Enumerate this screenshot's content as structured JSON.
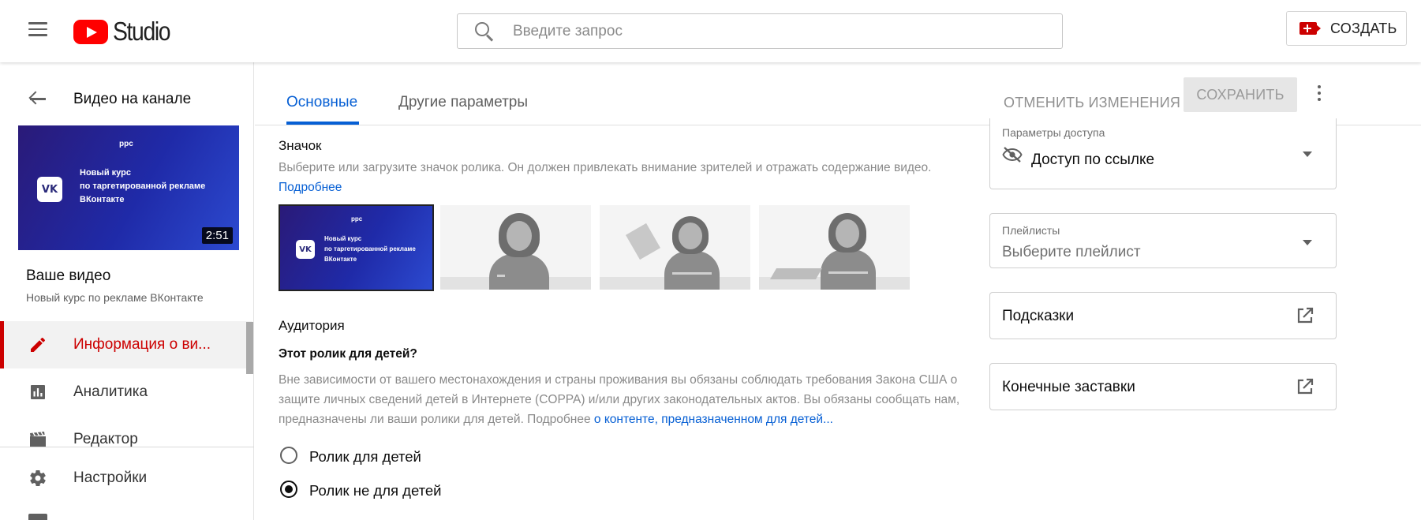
{
  "app": {
    "logo_text": "Studio",
    "search_placeholder": "Введите запрос",
    "create_label": "СОЗДАТЬ"
  },
  "sidebar": {
    "back_title": "Видео на канале",
    "thumbnail": {
      "brand": "ppc",
      "vk_mark": "VK",
      "course_lines": [
        "Новый курс",
        "по таргетированной рекламе",
        "ВКонтакте"
      ],
      "duration": "2:51"
    },
    "your_video_title": "Ваше видео",
    "your_video_subtitle": "Новый курс по рекламе ВКонтакте",
    "items": [
      {
        "label": "Информация о ви...",
        "icon": "pencil-icon",
        "active": true
      },
      {
        "label": "Аналитика",
        "icon": "analytics-icon",
        "active": false
      },
      {
        "label": "Редактор",
        "icon": "film-icon",
        "active": false
      },
      {
        "label": "Настройки",
        "icon": "gear-icon",
        "active": false
      }
    ]
  },
  "tabs": {
    "basic": "Основные",
    "other": "Другие параметры",
    "cancel": "ОТМЕНИТЬ ИЗМЕНЕНИЯ",
    "save": "СОХРАНИТЬ"
  },
  "main": {
    "thumbnail_section": {
      "title": "Значок",
      "description": "Выберите или загрузите значок ролика. Он должен привлекать внимание зрителей и отражать содержание видео.",
      "link": "Подробнее",
      "selected_thumb": {
        "brand": "ppc",
        "vk_mark": "VK",
        "course_lines": [
          "Новый курс",
          "по таргетированной рекламе",
          "ВКонтакте"
        ]
      }
    },
    "audience_section": {
      "title": "Аудитория",
      "question": "Этот ролик для детей?",
      "description": "Вне зависимости от вашего местонахождения и страны проживания вы обязаны соблюдать требования Закона США о защите личных сведений детей в Интернете (COPPA) и/или других законодательных актов. Вы обязаны сообщать нам, предназначены ли ваши ролики для детей. Подробнее",
      "link": "о контенте, предназначенном для детей...",
      "options": [
        {
          "label": "Ролик для детей",
          "checked": false
        },
        {
          "label": "Ролик не для детей",
          "checked": true
        }
      ]
    }
  },
  "right": {
    "visibility": {
      "label": "Параметры доступа",
      "value": "Доступ по ссылке",
      "icon": "eye-off-icon"
    },
    "playlists": {
      "label": "Плейлисты",
      "placeholder": "Выберите плейлист"
    },
    "hints": {
      "label": "Подсказки",
      "icon": "external-link-icon"
    },
    "end_screens": {
      "label": "Конечные заставки",
      "icon": "external-link-icon"
    }
  },
  "colors": {
    "brand_red": "#ff0000",
    "accent_blue": "#065fd4",
    "active_red": "#cc0000"
  }
}
